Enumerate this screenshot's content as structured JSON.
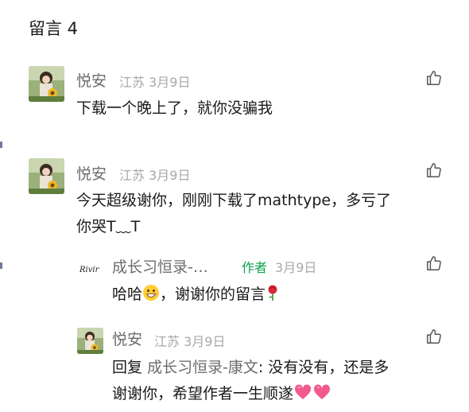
{
  "header": {
    "title": "留言 4"
  },
  "comments": [
    {
      "name": "悦安",
      "location": "江苏",
      "date": "3月9日",
      "text": "下载一个晚上了，就你没骗我"
    },
    {
      "name": "悦安",
      "location": "江苏",
      "date": "3月9日",
      "line1": "今天超级谢你，刚刚下载了mathtype，多亏了",
      "line2": "你哭T﹏T"
    }
  ],
  "replies": [
    {
      "name": "成长习恒录-…",
      "author_tag": "作者",
      "date": "3月9日",
      "avatar_text": "Rivir",
      "text_a": "哈哈",
      "text_b": "，谢谢你的留言"
    },
    {
      "name": "悦安",
      "location": "江苏",
      "date": "3月9日",
      "reply_prefix": "回复",
      "reply_target": "成长习恒录-康文",
      "line1_rest": ": 没有没有，还是多",
      "line2": "谢谢你，希望作者一生顺遂"
    }
  ],
  "icons": {
    "like": "thumbs-up-icon",
    "avatar": "girl-sunflower-avatar",
    "emoji_smile": "grinning-face-emoji",
    "emoji_rose": "rose-emoji",
    "emoji_heart": "pink-heart-emoji"
  }
}
